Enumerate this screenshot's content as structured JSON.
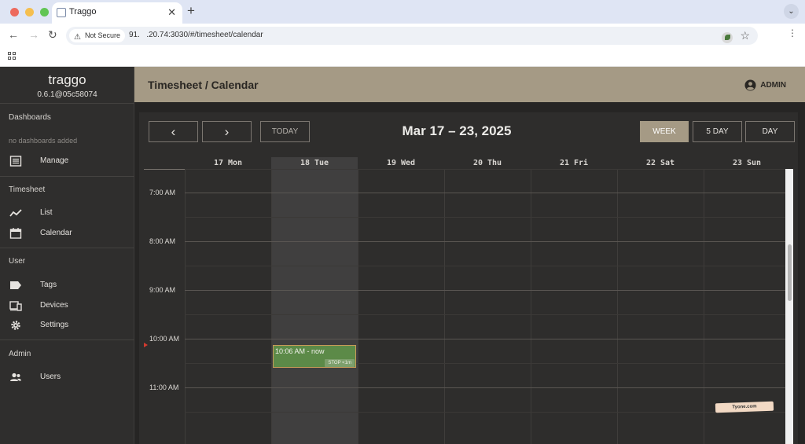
{
  "browser": {
    "tab_title": "Traggo",
    "security_label": "Not Secure",
    "url": "91.     .20.74:3030/#/timesheet/calendar",
    "traffic_lights": [
      "#ed6a5e",
      "#f5bf4f",
      "#61c554"
    ]
  },
  "sidebar": {
    "brand": "traggo",
    "version": "0.6.1@05c58074",
    "sections": {
      "dashboards": {
        "title": "Dashboards",
        "empty": "no dashboards added",
        "items": [
          {
            "label": "Manage",
            "icon": "list-icon"
          }
        ]
      },
      "timesheet": {
        "title": "Timesheet",
        "items": [
          {
            "label": "List",
            "icon": "trend-icon"
          },
          {
            "label": "Calendar",
            "icon": "calendar-icon"
          }
        ]
      },
      "user": {
        "title": "User",
        "items": [
          {
            "label": "Tags",
            "icon": "tag-icon"
          },
          {
            "label": "Devices",
            "icon": "devices-icon"
          },
          {
            "label": "Settings",
            "icon": "gear-icon"
          }
        ]
      },
      "admin": {
        "title": "Admin",
        "items": [
          {
            "label": "Users",
            "icon": "users-icon"
          }
        ]
      }
    }
  },
  "appbar": {
    "title": "Timesheet / Calendar",
    "user": "ADMIN",
    "color": "#a59a85"
  },
  "calendar": {
    "prev_label": "‹",
    "next_label": "›",
    "today_label": "TODAY",
    "range_title": "Mar 17 – 23, 2025",
    "views": [
      "WEEK",
      "5 DAY",
      "DAY"
    ],
    "active_view": "WEEK",
    "days": [
      "17 Mon",
      "18 Tue",
      "19 Wed",
      "20 Thu",
      "21 Fri",
      "22 Sat",
      "23 Sun"
    ],
    "today": "18 Tue",
    "hours": [
      "7:00 AM",
      "8:00 AM",
      "9:00 AM",
      "10:00 AM",
      "11:00 AM"
    ],
    "event": {
      "time": "10:06 AM - now",
      "stop_label": "STOP <1m",
      "color": "#5c8a48"
    }
  },
  "watermark": "Tyone.com"
}
